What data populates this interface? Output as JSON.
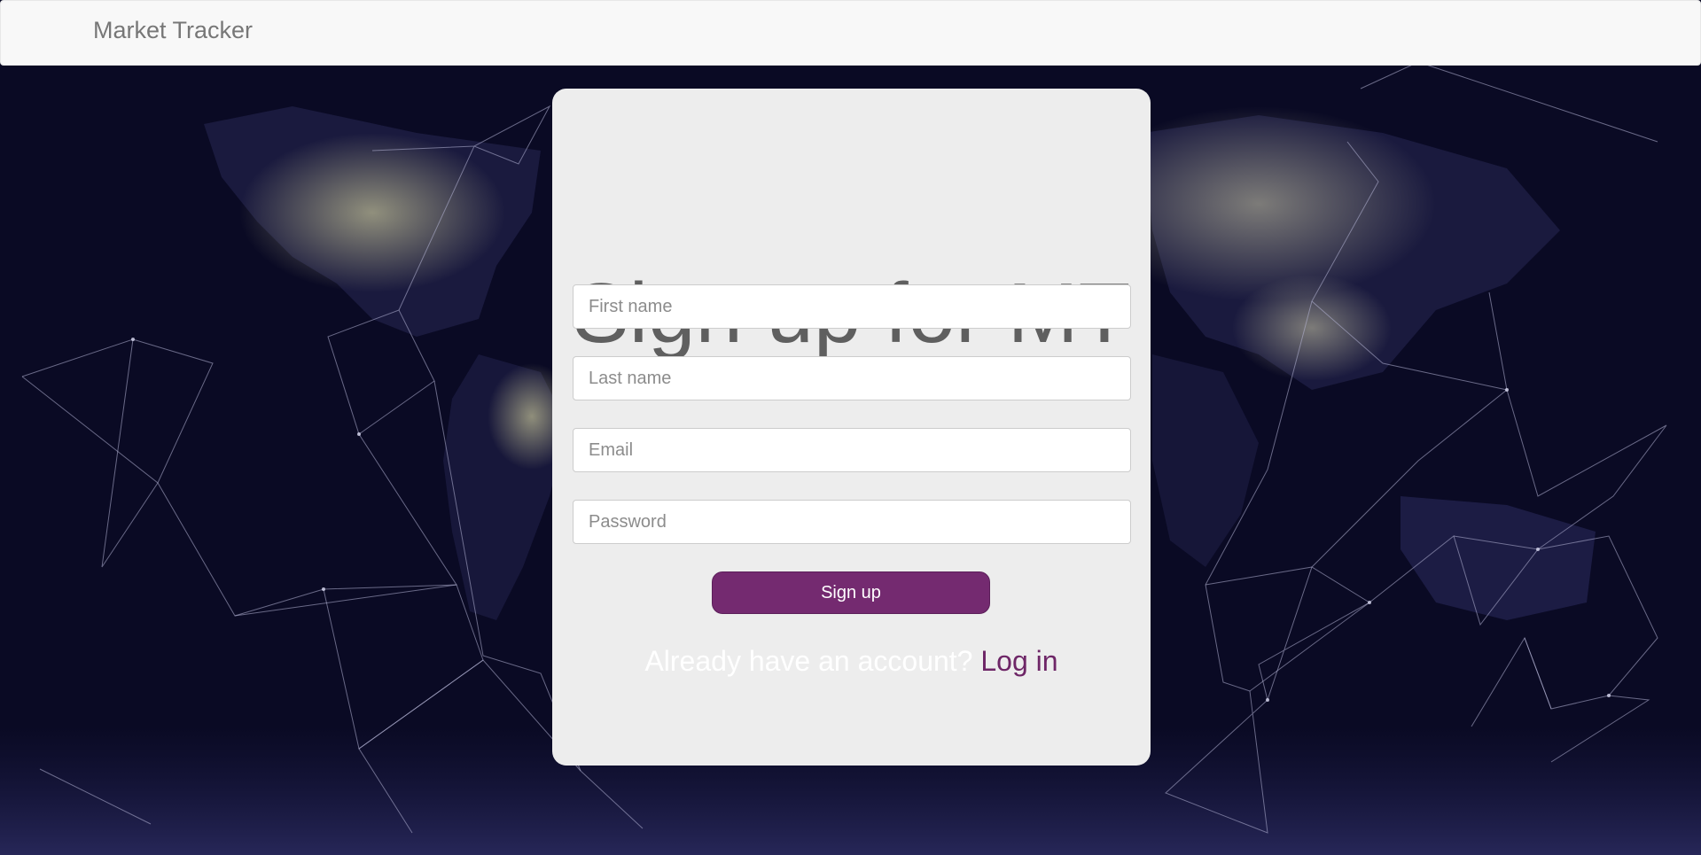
{
  "navbar": {
    "brand": "Market Tracker"
  },
  "signup": {
    "title": "Sign up for MT",
    "fields": {
      "first_name": {
        "placeholder": "First name",
        "value": ""
      },
      "last_name": {
        "placeholder": "Last name",
        "value": ""
      },
      "email": {
        "placeholder": "Email",
        "value": ""
      },
      "password": {
        "placeholder": "Password",
        "value": ""
      }
    },
    "submit_label": "Sign up",
    "login_prompt": "Already have an account?",
    "login_link": "Log in"
  },
  "colors": {
    "accent": "#742a70",
    "link": "#6e2667",
    "card_background": "#ededed",
    "page_background": "#08081e",
    "navbar_background": "#f8f8f8"
  },
  "icons": {
    "background": "world-map-night-network-image"
  }
}
